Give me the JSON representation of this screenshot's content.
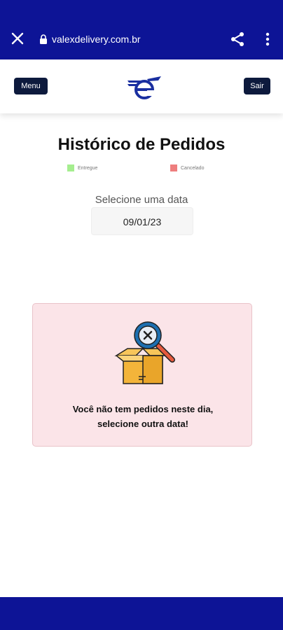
{
  "browser": {
    "url": "valexdelivery.com.br",
    "icons": [
      "close-icon",
      "lock-icon",
      "share-icon",
      "more-vert-icon"
    ]
  },
  "header": {
    "menu_label": "Menu",
    "logout_label": "Sair"
  },
  "page": {
    "title": "Histórico de Pedidos",
    "legend": [
      {
        "label": "Entregue",
        "color": "#a5ee8f"
      },
      {
        "label": "Cancelado",
        "color": "#ee7e7e"
      }
    ],
    "date_label": "Selecione uma data",
    "date_value": "09/01/23"
  },
  "empty_state": {
    "line1": "Você não tem pedidos neste dia,",
    "line2": "selecione outra data!"
  },
  "colors": {
    "browser_bar": "#0d1496",
    "button_dark": "#0d1a3d",
    "card_bg": "#fbe4e8"
  }
}
